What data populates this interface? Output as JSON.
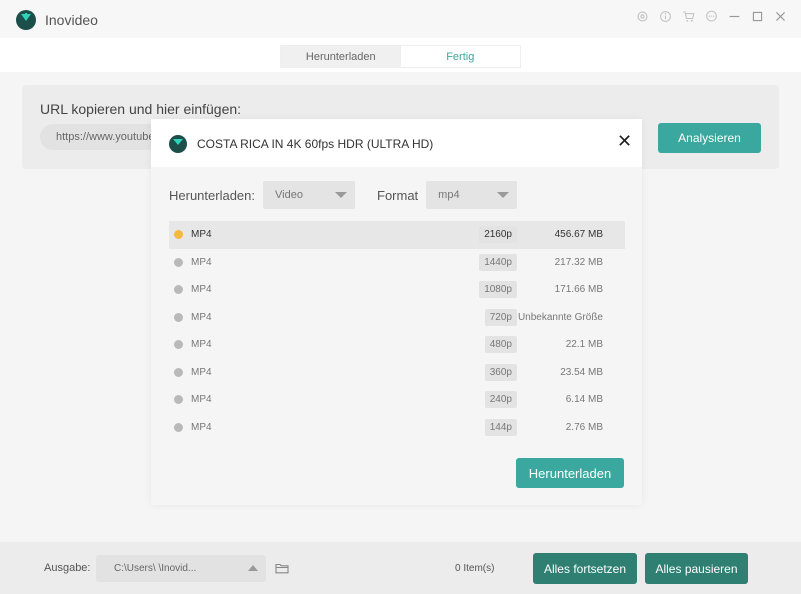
{
  "app": {
    "title": "Inovideo"
  },
  "titlebar": {
    "icons": [
      "gear-icon",
      "info-icon",
      "cart-icon",
      "chat-icon",
      "minimize-icon",
      "maximize-icon",
      "close-icon"
    ]
  },
  "tabs": [
    {
      "label": "Herunterladen",
      "active": false
    },
    {
      "label": "Fertig",
      "active": true
    }
  ],
  "url_panel": {
    "title": "URL kopieren und hier einfügen:",
    "value": "https://www.youtube",
    "analyze_label": "Analysieren"
  },
  "dialog": {
    "title": "COSTA RICA IN 4K 60fps HDR (ULTRA HD)",
    "download_label": "Herunterladen:",
    "download_type": "Video",
    "format_label": "Format",
    "format_value": "mp4",
    "rows": [
      {
        "format": "MP4",
        "resolution": "2160p",
        "size": "456.67 MB",
        "selected": true
      },
      {
        "format": "MP4",
        "resolution": "1440p",
        "size": "217.32 MB",
        "selected": false
      },
      {
        "format": "MP4",
        "resolution": "1080p",
        "size": "171.66 MB",
        "selected": false
      },
      {
        "format": "MP4",
        "resolution": "720p",
        "size": "Unbekannte Größe",
        "selected": false
      },
      {
        "format": "MP4",
        "resolution": "480p",
        "size": "22.1 MB",
        "selected": false
      },
      {
        "format": "MP4",
        "resolution": "360p",
        "size": "23.54 MB",
        "selected": false
      },
      {
        "format": "MP4",
        "resolution": "240p",
        "size": "6.14 MB",
        "selected": false
      },
      {
        "format": "MP4",
        "resolution": "144p",
        "size": "2.76 MB",
        "selected": false
      }
    ],
    "download_button": "Herunterladen"
  },
  "footer": {
    "output_label": "Ausgabe:",
    "output_path": "C:\\Users\\          \\Inovid...",
    "items_count": "0 Item(s)",
    "resume_all": "Alles fortsetzen",
    "pause_all": "Alles pausieren"
  },
  "colors": {
    "accent": "#3aa89e",
    "accent_dark": "#2f7f73",
    "selected_dot": "#f5b942"
  }
}
